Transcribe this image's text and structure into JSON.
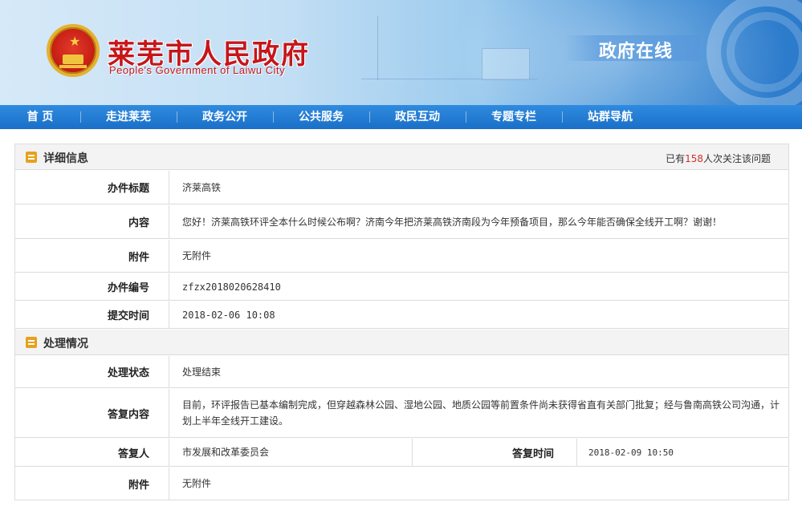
{
  "header": {
    "site_title": "莱芜市人民政府",
    "site_subtitle": "People's Government of Laiwu City",
    "tagline": "政府在线"
  },
  "nav": {
    "items": [
      "首 页",
      "走进莱芜",
      "政务公开",
      "公共服务",
      "政民互动",
      "专题专栏",
      "站群导航"
    ]
  },
  "detail": {
    "section_title": "详细信息",
    "attention_prefix": "已有",
    "attention_count": "158",
    "attention_suffix": "人次关注该问题",
    "rows": [
      {
        "label": "办件标题",
        "value": "济莱高铁"
      },
      {
        "label": "内容",
        "value": "您好！济莱高铁环评全本什么时候公布啊？济南今年把济莱高铁济南段为今年预备项目，那么今年能否确保全线开工啊？谢谢！"
      },
      {
        "label": "附件",
        "value": "无附件"
      },
      {
        "label": "办件编号",
        "value": "zfzx2018020628410"
      },
      {
        "label": "提交时间",
        "value": "2018-02-06 10:08"
      }
    ]
  },
  "handling": {
    "section_title": "处理情况",
    "rows": [
      {
        "label": "处理状态",
        "value": "处理结束"
      },
      {
        "label": "答复内容",
        "value": "目前，环评报告已基本编制完成，但穿越森林公园、湿地公园、地质公园等前置条件尚未获得省直有关部门批复；经与鲁南高铁公司沟通，计划上半年全线开工建设。"
      },
      {
        "label": "答复人",
        "value": "市发展和改革委员会",
        "label2": "答复时间",
        "value2": "2018-02-09 10:50"
      },
      {
        "label": "附件",
        "value": "无附件"
      }
    ]
  },
  "colors": {
    "title_red": "#c6161a",
    "nav_blue": "#1a6fc7",
    "icon_orange": "#e7a11c",
    "count_red": "#d03030"
  }
}
